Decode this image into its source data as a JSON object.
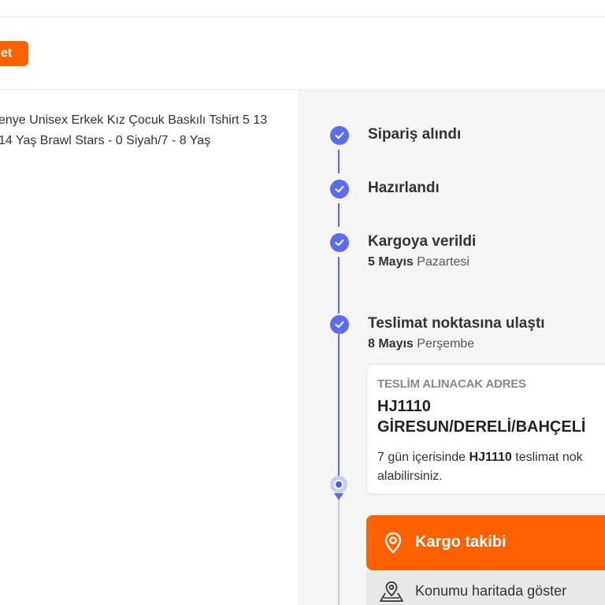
{
  "header": {
    "action_button_label": "et"
  },
  "product": {
    "title": "enye Unisex Erkek Kız Çocuk Baskılı Tshirt 5 13 14 Yaş Brawl Stars - 0 Siyah/7 - 8 Yaş"
  },
  "tracking": {
    "steps": [
      {
        "title": "Sipariş alındı",
        "date_bold": "",
        "date_rest": ""
      },
      {
        "title": "Hazırlandı",
        "date_bold": "",
        "date_rest": ""
      },
      {
        "title": "Kargoya verildi",
        "date_bold": "5 Mayıs",
        "date_rest": "Pazartesi"
      },
      {
        "title": "Teslimat noktasına ulaştı",
        "date_bold": "8 Mayıs",
        "date_rest": "Perşembe"
      }
    ],
    "address_card": {
      "label": "TESLİM ALINACAK ADRES",
      "line1": "HJ1110",
      "line2": "GİRESUN/DERELİ/BAHÇELİ",
      "note_prefix": "7 gün içerisinde",
      "note_code": "HJ1110",
      "note_suffix": "teslimat nok",
      "note_line2": "alabilirsiniz."
    },
    "cargo_button_label": "Kargo takibi",
    "map_link_label": "Konumu haritada göster"
  },
  "colors": {
    "accent": "#ff6000",
    "timeline": "#5b6cf0",
    "panel_bg": "#f5f5f5"
  },
  "icons": {
    "step": "check-icon",
    "cargo": "location-pin-icon",
    "map": "map-pin-icon"
  }
}
